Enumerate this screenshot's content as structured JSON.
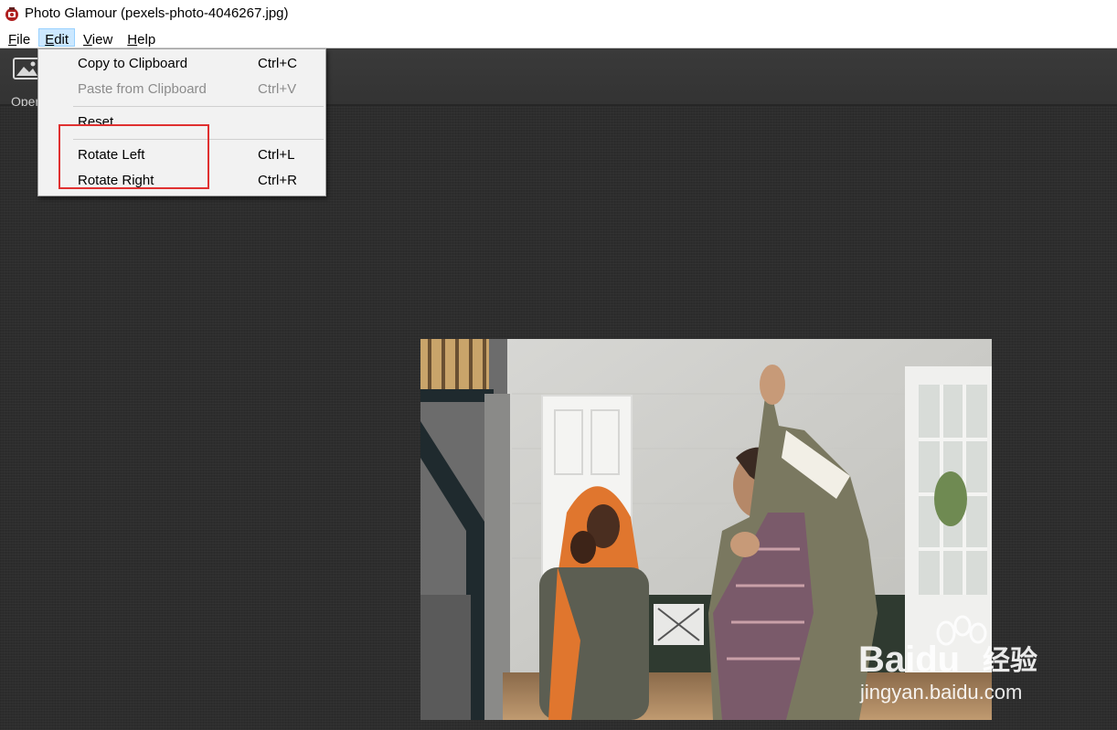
{
  "window": {
    "title": "Photo Glamour (pexels-photo-4046267.jpg)"
  },
  "menubar": {
    "items": [
      {
        "key": "F",
        "rest": "ile"
      },
      {
        "key": "E",
        "rest": "dit"
      },
      {
        "key": "V",
        "rest": "iew"
      },
      {
        "key": "H",
        "rest": "elp"
      }
    ]
  },
  "toolbar": {
    "open_label": "Open"
  },
  "edit_menu": {
    "items": [
      {
        "label": "Copy to Clipboard",
        "shortcut": "Ctrl+C",
        "enabled": true
      },
      {
        "label": "Paste from Clipboard",
        "shortcut": "Ctrl+V",
        "enabled": false
      },
      {
        "label": "Reset",
        "shortcut": "",
        "enabled": true
      },
      {
        "label": "Rotate Left",
        "shortcut": "Ctrl+L",
        "enabled": true
      },
      {
        "label": "Rotate Right",
        "shortcut": "Ctrl+R",
        "enabled": true
      }
    ]
  },
  "watermark": {
    "brand": "Baidu",
    "brand_cn": "经验",
    "url": "jingyan.baidu.com"
  },
  "colors": {
    "accent_highlight": "#cce8ff",
    "annotation_red": "#e03030",
    "canvas_bg": "#2d2d2d"
  }
}
